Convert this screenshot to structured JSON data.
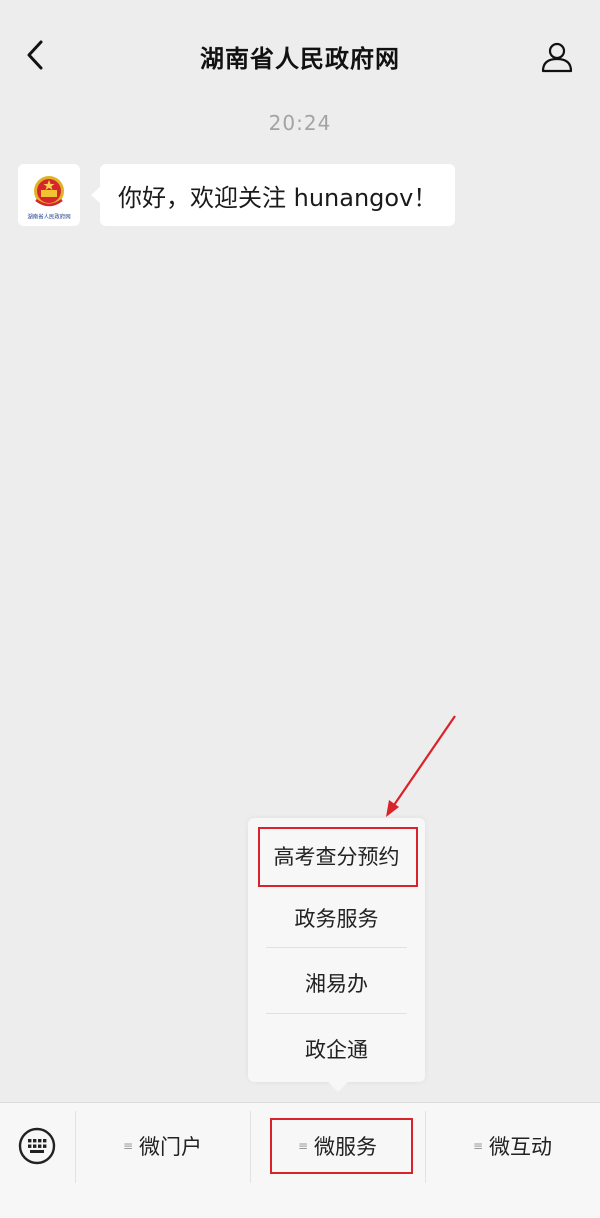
{
  "header": {
    "title": "湖南省人民政府网",
    "back_icon": "chevron-left-icon",
    "profile_icon": "user-profile-icon"
  },
  "chat": {
    "timestamp": "20:24",
    "messages": [
      {
        "sender_avatar_label": "湖南省人民政府网",
        "text": "你好，欢迎关注 hunangov！"
      }
    ]
  },
  "popup_menu": {
    "items": [
      {
        "label": "高考查分预约",
        "highlighted": true
      },
      {
        "label": "政务服务"
      },
      {
        "label": "湘易办"
      },
      {
        "label": "政企通"
      }
    ]
  },
  "bottom_menu": {
    "keyboard_icon": "keyboard-icon",
    "tabs": [
      {
        "label": "微门户"
      },
      {
        "label": "微服务",
        "highlighted": true
      },
      {
        "label": "微互动"
      }
    ]
  },
  "annotations": {
    "highlight_color": "#d9222a"
  }
}
